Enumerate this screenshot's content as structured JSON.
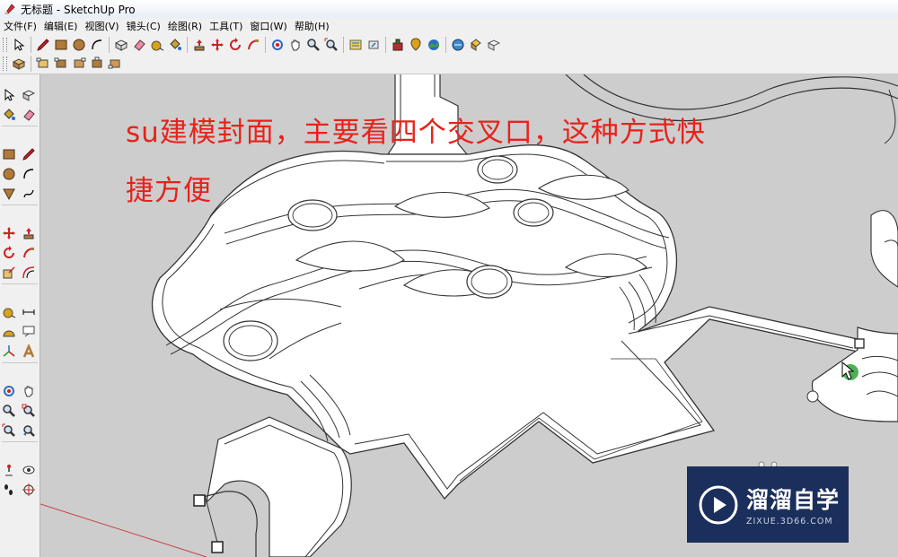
{
  "window": {
    "title": "无标题 - SketchUp Pro"
  },
  "menu": {
    "items": [
      "文件(F)",
      "编辑(E)",
      "视图(V)",
      "镜头(C)",
      "绘图(R)",
      "工具(T)",
      "窗口(W)",
      "帮助(H)"
    ]
  },
  "toolbar_main": {
    "icons": [
      "select-icon",
      "pencil-icon",
      "rectangle-icon",
      "circle-icon",
      "arc-icon",
      "make-component-icon",
      "eraser-icon",
      "tape-measure-icon",
      "paint-bucket-icon",
      "push-pull-icon",
      "move-icon",
      "rotate-icon",
      "follow-me-icon",
      "orbit-icon",
      "pan-icon",
      "zoom-icon",
      "zoom-extents-icon",
      "warehouse-icon",
      "share-model-icon",
      "extension-icon",
      "add-location-icon",
      "toggle-terrain-icon",
      "geo-photo-icon",
      "preview-google-earth-icon",
      "component-library-icon"
    ]
  },
  "toolbar_views": {
    "icons": [
      "iso-view-icon",
      "top-view-icon",
      "front-view-icon",
      "right-view-icon",
      "back-view-icon",
      "left-view-icon"
    ]
  },
  "left_toolbar": {
    "icons": [
      "select-icon",
      "make-component-icon",
      "paint-bucket-icon",
      "eraser-icon",
      "rectangle-icon",
      "line-icon",
      "circle-icon",
      "arc-icon",
      "polygon-icon",
      "freehand-icon",
      "move-icon",
      "push-pull-icon",
      "rotate-icon",
      "follow-me-icon",
      "scale-icon",
      "offset-icon",
      "tape-measure-icon",
      "dimension-icon",
      "protractor-icon",
      "text-icon",
      "axes-icon",
      "3d-text-icon",
      "orbit-icon",
      "pan-icon",
      "zoom-icon",
      "zoom-window-icon",
      "zoom-extents-icon",
      "previous-view-icon",
      "position-camera-icon",
      "look-around-icon",
      "walk-icon",
      "section-plane-icon"
    ]
  },
  "annotation": {
    "line1": "su建模封面，主要看四个交叉口，这种方式快",
    "line2": "捷方便"
  },
  "watermark": {
    "title": "溜溜自学",
    "subtitle": "ZIXUE.3D66.COM"
  },
  "colors": {
    "annotation": "#e8221a",
    "viewport": "#cdcdcd",
    "watermark_bg": "#1b2f5c",
    "cursor_highlight": "#2fa33a"
  }
}
